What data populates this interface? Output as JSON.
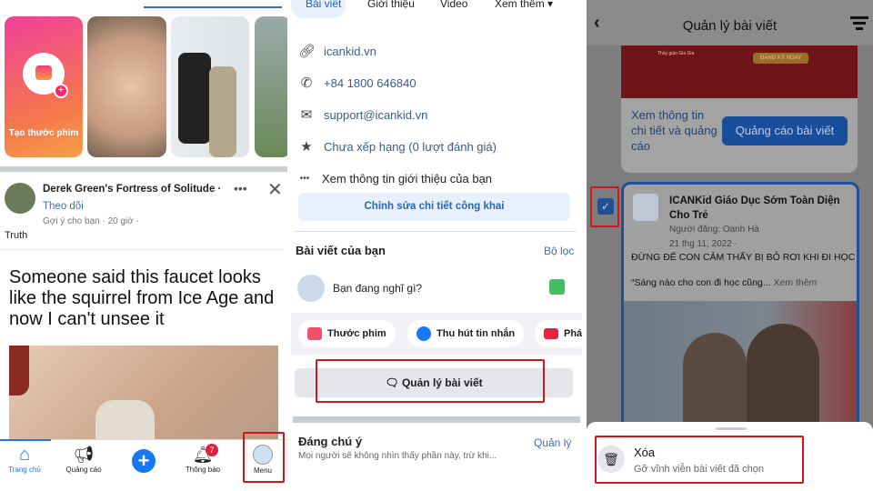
{
  "panel1": {
    "reel_create_label": "Tạo thước phim",
    "post": {
      "author": "Derek Green's Fortress of Solitude ·",
      "follow": "Theo dõi",
      "meta": "Gợi ý cho bạn · 20 giờ ·",
      "caption": "Truth",
      "meme_text": "Someone said this faucet looks like the squirrel from Ice Age and now I can't unsee it"
    },
    "nav": {
      "home": "Trang chủ",
      "ads": "Quảng cáo",
      "notifications": "Thông báo",
      "notification_count": "7",
      "menu": "Menu"
    }
  },
  "panel2": {
    "tabs": [
      "Bài viết",
      "Giới thiệu",
      "Video",
      "Xem thêm"
    ],
    "info": {
      "website": "icankid.vn",
      "phone": "+84 1800 646840",
      "email": "support@icankid.vn",
      "rating": "Chưa xếp hạng (0 lượt đánh giá)",
      "about": "Xem thông tin giới thiệu của bạn"
    },
    "edit_button": "Chỉnh sửa chi tiết công khai",
    "posts_title": "Bài viết của bạn",
    "filter": "Bộ lọc",
    "composer_placeholder": "Bạn đang nghĩ gì?",
    "chips": [
      "Thước phim",
      "Thu hút tin nhắn",
      "Phá"
    ],
    "manage_posts": "Quản lý bài viết",
    "featured_title": "Đáng chú ý",
    "featured_manage": "Quản lý",
    "featured_desc": "Mọi người sẽ không nhìn thấy phần này, trừ khi..."
  },
  "panel3": {
    "title": "Quản lý bài viết",
    "banner": {
      "line1": "Thầy giáo Gia Gia",
      "cta": "ĐĂNG KÝ NGAY"
    },
    "insights_link": "Xem thông tin chi tiết và quảng cáo",
    "boost_button": "Quảng cáo bài viết",
    "post": {
      "page": "ICANKid Giáo Dục Sớm Toàn Diện Cho Trẻ",
      "poster": "Người đăng: Oanh Hà",
      "date": "21 thg 11, 2022 ·",
      "headline": "ĐỪNG ĐỂ CON CẢM THẤY BỊ BỎ RƠI KHI ĐI HỌC",
      "excerpt": "“Sáng nào cho con đi học cũng...",
      "more": "Xem thêm",
      "checked": true
    },
    "sheet": {
      "delete_title": "Xóa",
      "delete_desc": "Gỡ vĩnh viễn bài viết đã chọn"
    }
  },
  "colors": {
    "fb_blue": "#1877f2",
    "link": "#3b5b8f",
    "highlight": "#d0161b"
  }
}
